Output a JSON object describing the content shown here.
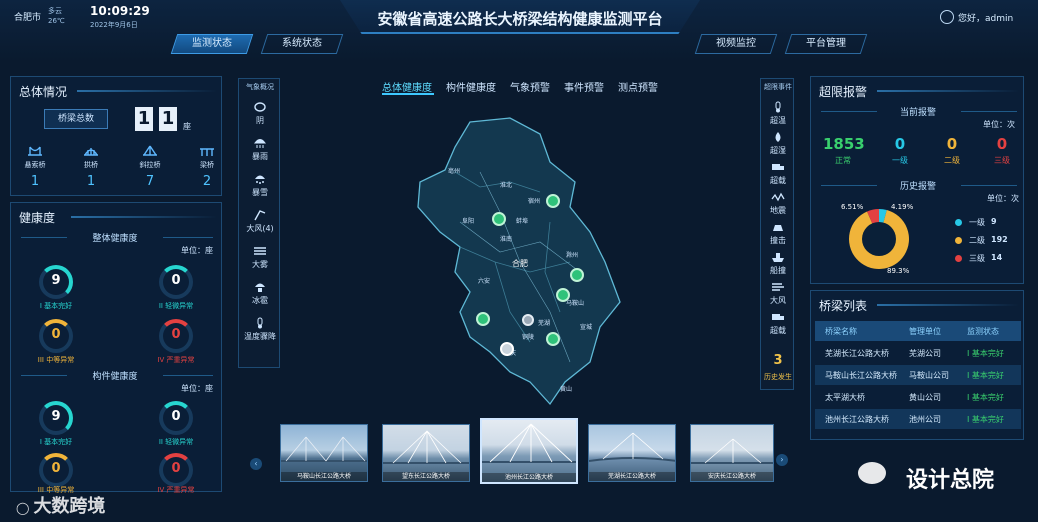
{
  "header": {
    "city": "合肥市",
    "weather": "多云",
    "temperature": "26℃",
    "time": "10:09:29",
    "date": "2022年9月6日",
    "title": "安徽省高速公路长大桥梁结构健康监测平台",
    "greeting": "您好，admin",
    "nav": [
      "监测状态",
      "系统状态",
      "视频监控",
      "平台管理"
    ]
  },
  "overview": {
    "title": "总体情况",
    "total_label": "桥梁总数",
    "digits": [
      "1",
      "1"
    ],
    "unit": "座",
    "types": [
      {
        "label": "悬索桥",
        "value": "1"
      },
      {
        "label": "拱桥",
        "value": "1"
      },
      {
        "label": "斜拉桥",
        "value": "7"
      },
      {
        "label": "梁桥",
        "value": "2"
      }
    ]
  },
  "health": {
    "title": "健康度",
    "overall_label": "整体健康度",
    "overall_unit": "单位：座",
    "overall": [
      {
        "value": "9",
        "label": "I 基本完好",
        "color": "#27d6d0"
      },
      {
        "value": "0",
        "label": "II 轻微异常",
        "color": "#27d6d0"
      },
      {
        "value": "0",
        "label": "III 中等异常",
        "color": "#f0b43a"
      },
      {
        "value": "0",
        "label": "IV 严重异常",
        "color": "#e34141"
      }
    ],
    "component_label": "构件健康度",
    "component_unit": "单位：座",
    "component": [
      {
        "value": "9",
        "label": "I 基本完好",
        "color": "#27d6d0"
      },
      {
        "value": "0",
        "label": "II 轻微异常",
        "color": "#27d6d0"
      },
      {
        "value": "0",
        "label": "III 中等异常",
        "color": "#f0b43a"
      },
      {
        "value": "0",
        "label": "IV 严重异常",
        "color": "#e34141"
      }
    ]
  },
  "weather_panel": {
    "title": "气象概况",
    "items": [
      "阴",
      "暴雨",
      "暴雪",
      "大风(4)",
      "大雾",
      "冰雹",
      "温度骤降"
    ]
  },
  "map_tabs": [
    "总体健康度",
    "构件健康度",
    "气象预警",
    "事件预警",
    "测点预警"
  ],
  "map_labels": [
    "亳州",
    "淮北",
    "宿州",
    "阜阳",
    "蚌埠",
    "淮南",
    "滁州",
    "合肥",
    "六安",
    "马鞍山",
    "芜湖",
    "铜陵",
    "宣城",
    "安庆",
    "黄山"
  ],
  "events": {
    "title": "超限事件",
    "items": [
      "超温",
      "超湿",
      "超载",
      "地震",
      "撞击",
      "船撞",
      "大风",
      "超载"
    ],
    "count": "3",
    "history_label": "历史发生"
  },
  "alarm": {
    "title": "超限报警",
    "current_label": "当前报警",
    "unit": "单位：次",
    "stats": [
      {
        "value": "1853",
        "label": "正常",
        "color": "#39d06e"
      },
      {
        "value": "0",
        "label": "一级",
        "color": "#27c8e6"
      },
      {
        "value": "0",
        "label": "二级",
        "color": "#f0b43a"
      },
      {
        "value": "0",
        "label": "三级",
        "color": "#e34141"
      }
    ],
    "history_label": "历史报警",
    "history_unit": "单位：次",
    "pie": {
      "slices": [
        {
          "name": "一级",
          "value": 9,
          "pct": "4.19%",
          "color": "#27c8e6"
        },
        {
          "name": "二级",
          "value": 192,
          "pct": "89.3%",
          "color": "#f0b43a"
        },
        {
          "name": "三级",
          "value": 14,
          "pct": "6.51%",
          "color": "#e34141"
        }
      ]
    }
  },
  "bridge_list": {
    "title": "桥梁列表",
    "columns": [
      "桥梁名称",
      "管理单位",
      "监测状态"
    ],
    "rows": [
      [
        "芜湖长江公路大桥",
        "芜湖公司",
        "I 基本完好"
      ],
      [
        "马鞍山长江公路大桥",
        "马鞍山公司",
        "I 基本完好"
      ],
      [
        "太平湖大桥",
        "黄山公司",
        "I 基本完好"
      ],
      [
        "池州长江公路大桥",
        "池州公司",
        "I 基本完好"
      ]
    ]
  },
  "photos": [
    "马鞍山长江公路大桥",
    "望东长江公路大桥",
    "池州长江公路大桥",
    "芜湖长江公路大桥",
    "安庆长江公路大桥"
  ],
  "watermark": {
    "left": "大数跨境",
    "right": "设计总院"
  }
}
